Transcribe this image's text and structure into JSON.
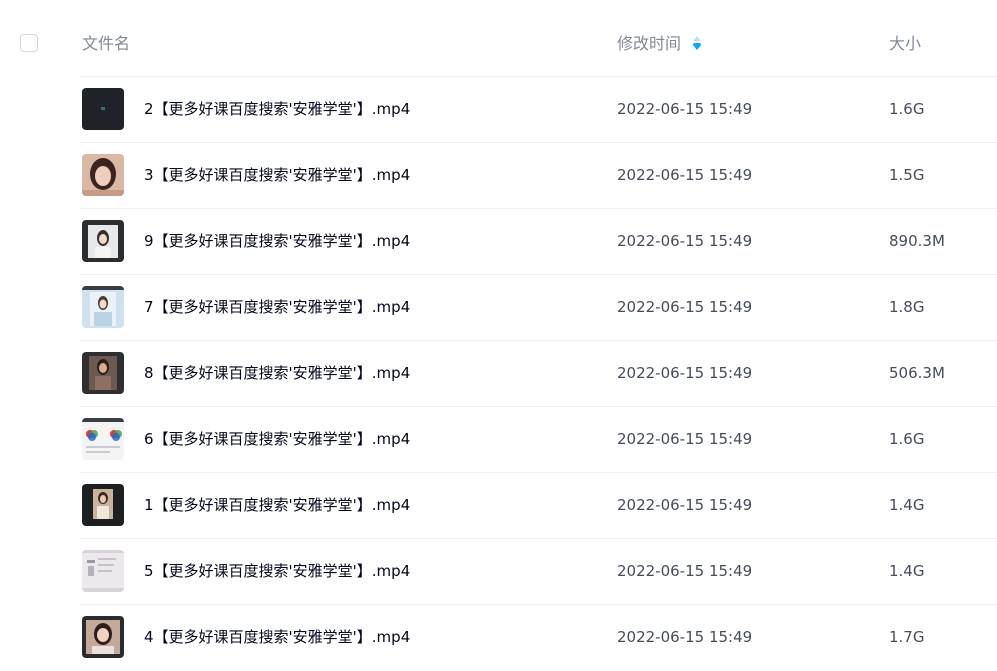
{
  "header": {
    "name_label": "文件名",
    "time_label": "修改时间",
    "size_label": "大小",
    "sort_icon": "sort-descending-icon",
    "sort_color_active": "#06a7ff",
    "sort_color_inactive": "#c4d8f4"
  },
  "files": [
    {
      "name": "2【更多好课百度搜索'安雅学堂'】.mp4",
      "time": "2022-06-15 15:49",
      "size": "1.6G",
      "thumb": "dark-video-thumbnail"
    },
    {
      "name": "3【更多好课百度搜索'安雅学堂'】.mp4",
      "time": "2022-06-15 15:49",
      "size": "1.5G",
      "thumb": "portrait-woman-thumbnail"
    },
    {
      "name": "9【更多好课百度搜索'安雅学堂'】.mp4",
      "time": "2022-06-15 15:49",
      "size": "890.3M",
      "thumb": "photo-editor-portrait-thumbnail"
    },
    {
      "name": "7【更多好课百度搜索'安雅学堂'】.mp4",
      "time": "2022-06-15 15:49",
      "size": "1.8G",
      "thumb": "light-blue-portrait-thumbnail"
    },
    {
      "name": "8【更多好课百度搜索'安雅学堂'】.mp4",
      "time": "2022-06-15 15:49",
      "size": "506.3M",
      "thumb": "dark-portrait-thumbnail"
    },
    {
      "name": "6【更多好课百度搜索'安雅学堂'】.mp4",
      "time": "2022-06-15 15:49",
      "size": "1.6G",
      "thumb": "color-wheel-thumbnail"
    },
    {
      "name": "1【更多好课百度搜索'安雅学堂'】.mp4",
      "time": "2022-06-15 15:49",
      "size": "1.4G",
      "thumb": "dark-editor-portrait-thumbnail"
    },
    {
      "name": "5【更多好课百度搜索'安雅学堂'】.mp4",
      "time": "2022-06-15 15:49",
      "size": "1.4G",
      "thumb": "pale-document-thumbnail"
    },
    {
      "name": "4【更多好课百度搜索'安雅学堂'】.mp4",
      "time": "2022-06-15 15:49",
      "size": "1.7G",
      "thumb": "portrait-woman-dark-thumbnail"
    }
  ]
}
